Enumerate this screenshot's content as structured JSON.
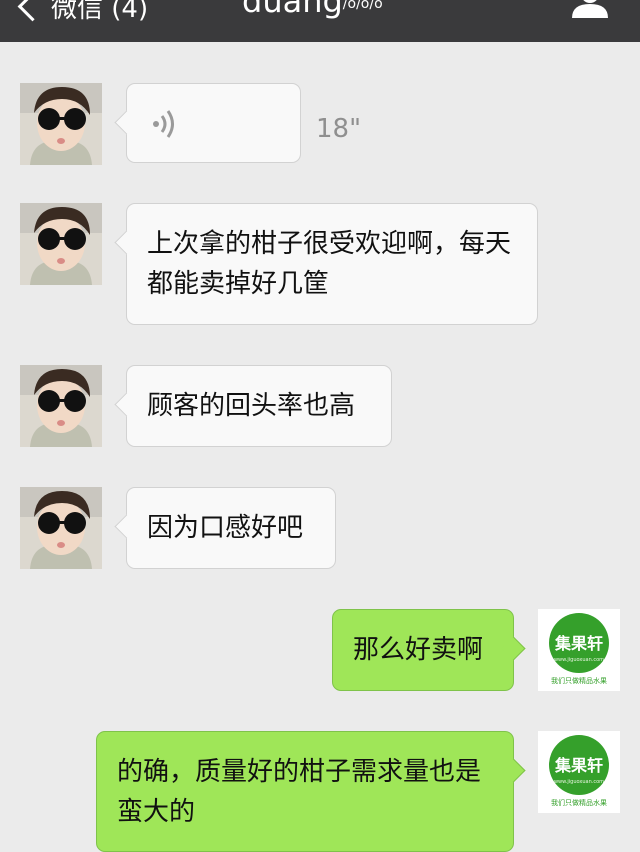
{
  "header": {
    "back_label": "微信 (4)",
    "title": "duang",
    "title_suffix": "/ö/ö/ö"
  },
  "messages": [
    {
      "side": "in",
      "type": "voice",
      "duration": "18\""
    },
    {
      "side": "in",
      "type": "text",
      "text": "上次拿的柑子很受欢迎啊，每天都能卖掉好几筐"
    },
    {
      "side": "in",
      "type": "text",
      "text": "顾客的回头率也高"
    },
    {
      "side": "in",
      "type": "text",
      "text": "因为口感好吧"
    },
    {
      "side": "out",
      "type": "text",
      "text": "那么好卖啊"
    },
    {
      "side": "out",
      "type": "text",
      "text": "的确，质量好的柑子需求量也是蛮大的"
    }
  ],
  "logo": {
    "name": "集果轩",
    "url": "www.jiguoxuan.com",
    "caption": "我们只做精品水果",
    "brand_color": "#35a02b"
  },
  "colors": {
    "topbar": "#3a3a3c",
    "background": "#ebebeb",
    "incoming_bubble": "#f9f9f9",
    "outgoing_bubble": "#9fe658"
  }
}
